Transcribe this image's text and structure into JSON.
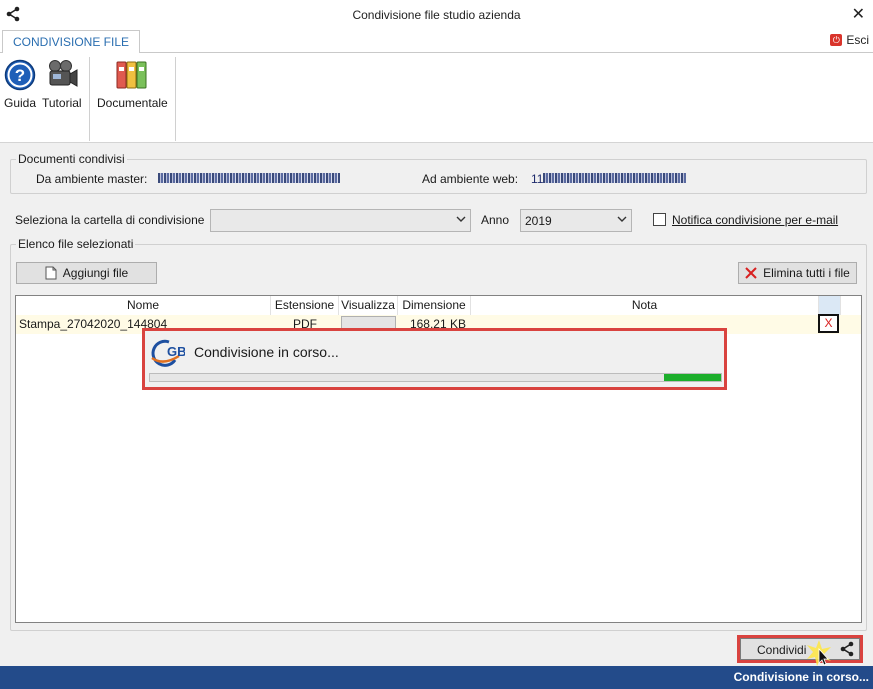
{
  "window": {
    "title": "Condivisione file studio azienda",
    "close_glyph": "✕"
  },
  "tabs": [
    {
      "label": "CONDIVISIONE FILE"
    }
  ],
  "exit": {
    "label": "Esci",
    "icon": "power-icon"
  },
  "ribbon": {
    "buttons": [
      {
        "label": "Guida",
        "icon": "help-icon"
      },
      {
        "label": "Tutorial",
        "icon": "video-camera-icon"
      },
      {
        "label": "Documentale",
        "icon": "binders-icon"
      }
    ]
  },
  "shared_docs": {
    "legend": "Documenti condivisi",
    "master_label": "Da ambiente master:",
    "web_label": "Ad ambiente web:",
    "web_prefix": "11"
  },
  "folder": {
    "label": "Seleziona la cartella di condivisione",
    "value": ""
  },
  "year": {
    "label": "Anno",
    "value": "2019"
  },
  "notify": {
    "label": "Notifica condivisione per e-mail",
    "checked": false
  },
  "files": {
    "legend": "Elenco file selezionati",
    "add_label": "Aggiungi file",
    "delete_all_label": "Elimina tutti i file",
    "columns": [
      "Nome",
      "Estensione",
      "Visualizza",
      "Dimensione",
      "Nota"
    ],
    "rows": [
      {
        "name": "Stampa_27042020_144804",
        "ext": "PDF",
        "size": "168,21 KB",
        "note": "",
        "delete": "X"
      }
    ]
  },
  "progress": {
    "message": "Condivisione in corso...",
    "logo": "GB",
    "level": 0.1
  },
  "actions": {
    "share_label": "Condividi"
  },
  "status": {
    "text": "Condivisione in corso..."
  },
  "colors": {
    "accent": "#2a6eb0",
    "status_bar": "#234b8a",
    "highlight": "#d9433f",
    "progress": "#1cae2b"
  }
}
